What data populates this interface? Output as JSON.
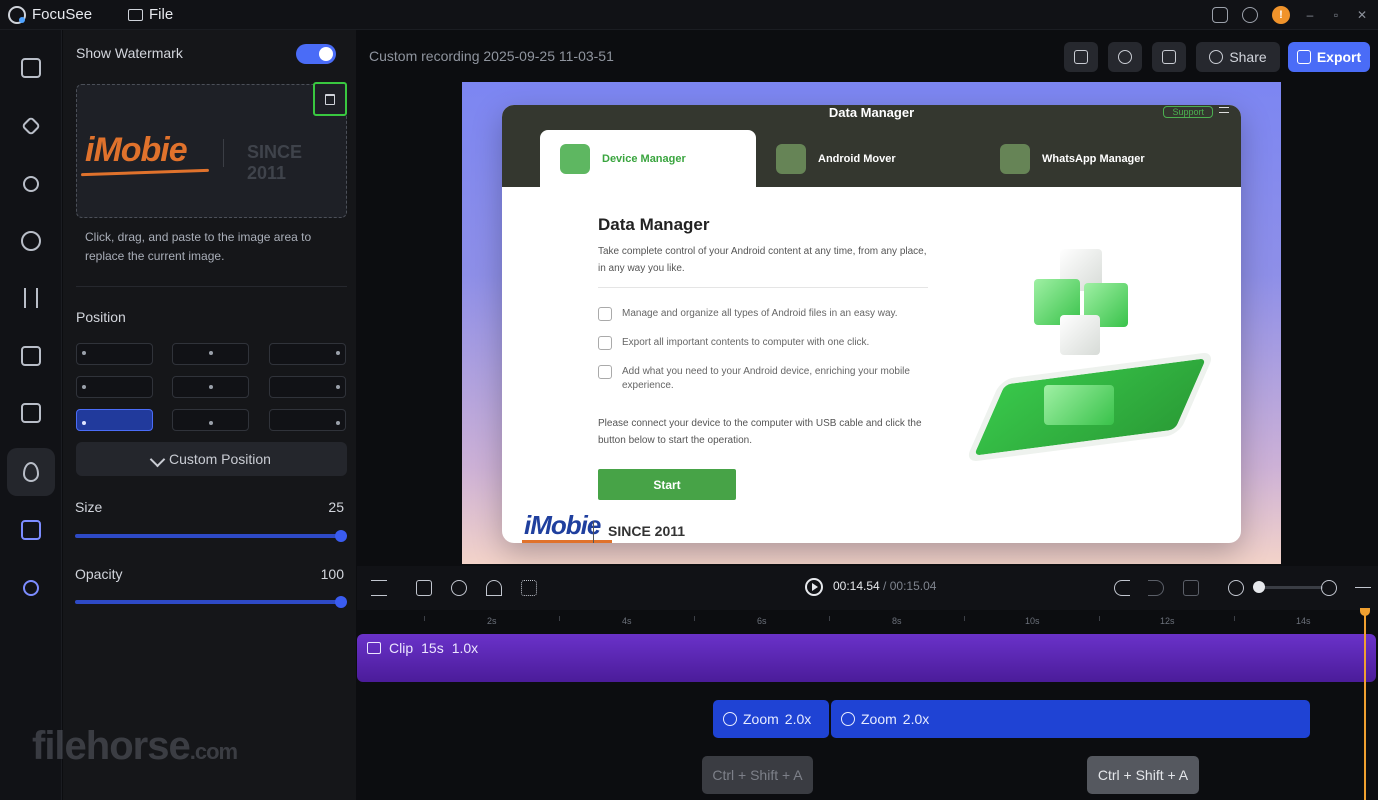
{
  "app": {
    "name": "FocuSee",
    "file_menu": "File"
  },
  "titlebar_icons": [
    "feedback-icon",
    "settings-icon",
    "notification-badge-icon",
    "minimize-icon",
    "restore-icon",
    "close-icon"
  ],
  "titlebar_badge": "!",
  "rail": {
    "items": [
      {
        "name": "background-icon"
      },
      {
        "name": "cursor-icon"
      },
      {
        "name": "path-icon"
      },
      {
        "name": "camera-icon"
      },
      {
        "name": "audio-icon"
      },
      {
        "name": "captions-icon"
      },
      {
        "name": "sticker-icon"
      },
      {
        "name": "watermark-icon",
        "active": true
      },
      {
        "name": "ai-chat-icon"
      },
      {
        "name": "add-user-icon"
      }
    ]
  },
  "panel": {
    "show_watermark_label": "Show Watermark",
    "show_watermark_on": true,
    "watermark_image": {
      "brand": "iMobie",
      "tagline": "SINCE 2011"
    },
    "hint": "Click, drag, and paste to the image area to replace the current image.",
    "position_label": "Position",
    "position_selected": "bottom-left",
    "custom_position": "Custom Position",
    "size_label": "Size",
    "size_value": "25",
    "opacity_label": "Opacity",
    "opacity_value": "100"
  },
  "header": {
    "title": "Custom recording 2025-09-25 11-03-51",
    "share": "Share",
    "export": "Export",
    "accent": "#4a6cf7"
  },
  "preview": {
    "app_title": "Data Manager",
    "support": "Support",
    "tabs": [
      "Device Manager",
      "Android Mover",
      "WhatsApp Manager"
    ],
    "heading": "Data Manager",
    "intro": "Take complete control of your Android content at any time, from any place, in any way you like.",
    "features": [
      "Manage and organize all types of Android files in an easy way.",
      "Export all important contents to computer with one click.",
      "Add what you need to your Android device, enriching your mobile experience."
    ],
    "connect_text": "Please connect your device to the computer with USB cable and click the button below to start the operation.",
    "start": "Start",
    "watermark_brand": "iMobie",
    "watermark_tagline": "SINCE 2011"
  },
  "transport": {
    "current": "00:14.54",
    "separator": " / ",
    "total": "00:15.04"
  },
  "timeline": {
    "ticks": [
      "2s",
      "4s",
      "6s",
      "8s",
      "10s",
      "12s",
      "14s"
    ],
    "clip": {
      "label": "Clip",
      "duration": "15s",
      "speed": "1.0x"
    },
    "zooms": [
      {
        "label": "Zoom",
        "factor": "2.0x"
      },
      {
        "label": "Zoom",
        "factor": "2.0x"
      }
    ],
    "keys": [
      "Ctrl + Shift + A",
      "Ctrl + Shift + A"
    ]
  },
  "site_watermark": {
    "main": "filehorse",
    "suffix": ".com"
  }
}
